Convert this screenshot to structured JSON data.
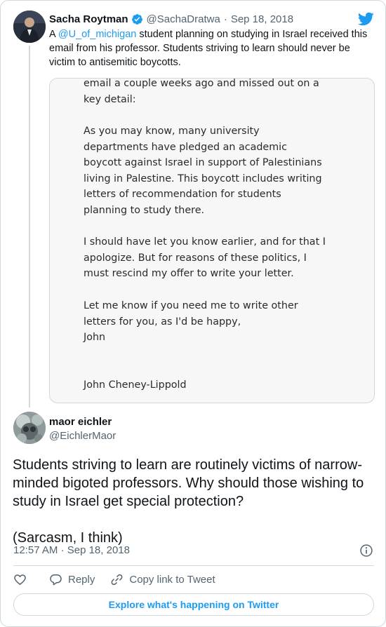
{
  "quoted_tweet": {
    "name": "Sacha Roytman",
    "handle": "@SachaDratwa",
    "separator": "·",
    "date": "Sep 18, 2018",
    "text_before_mention": "A ",
    "mention": "@U_of_michigan",
    "text_after_mention": " student planning on studying in Israel received this email from his professor. Students striving to learn should never be victim to antisemitic boycotts.",
    "email_image": {
      "p1": [
        "email a couple weeks ago and missed out on a",
        "key detail:"
      ],
      "p2": [
        "As you may know, many university",
        "departments have pledged an academic",
        "boycott against Israel in support of Palestinians",
        "living in Palestine. This boycott includes writing",
        "letters of recommendation for students",
        "planning to study there."
      ],
      "p3": [
        "I should have let you know earlier, and for that I",
        "apologize. But for reasons of these politics, I",
        "must rescind my offer to write your letter."
      ],
      "p4": [
        "Let me know if you need me to write other",
        "letters for you, as I'd be happy,",
        "John"
      ],
      "signature": "John Cheney-Lippold"
    }
  },
  "tweet": {
    "name": "maor eichler",
    "handle": "@EichlerMaor",
    "text": "Students striving to learn are routinely victims of narrow-minded bigoted professors. Why should those wishing to study in Israel get special protection?",
    "text2": "(Sarcasm, I think)",
    "time": "12:57 AM",
    "separator": "·",
    "date": "Sep 18, 2018"
  },
  "actions": {
    "reply_label": "Reply",
    "copy_label": "Copy link to Tweet"
  },
  "explore_label": "Explore what's happening on Twitter",
  "colors": {
    "accent": "#1d9bf0",
    "secondary_text": "#536471",
    "border": "#cfd9de"
  },
  "icons": [
    "verified-badge-icon",
    "twitter-bird-icon",
    "info-icon",
    "heart-icon",
    "reply-icon",
    "link-icon"
  ]
}
